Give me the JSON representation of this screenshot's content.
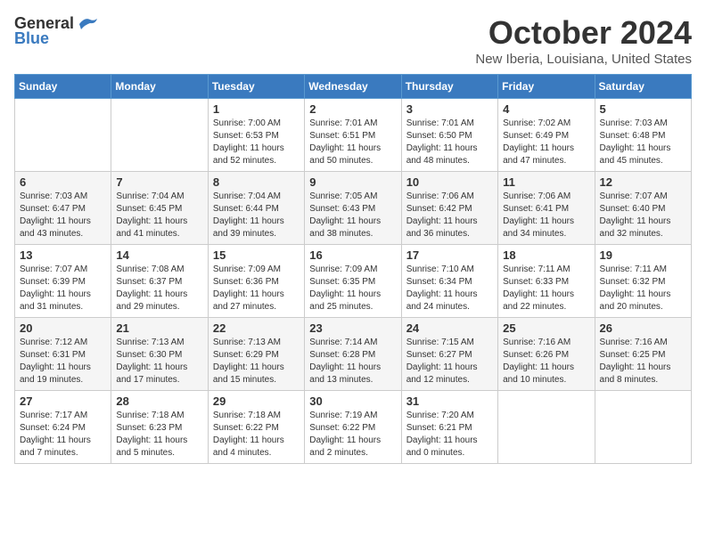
{
  "header": {
    "logo": {
      "general": "General",
      "blue": "Blue",
      "tagline": ""
    },
    "title": "October 2024",
    "location": "New Iberia, Louisiana, United States"
  },
  "weekdays": [
    "Sunday",
    "Monday",
    "Tuesday",
    "Wednesday",
    "Thursday",
    "Friday",
    "Saturday"
  ],
  "weeks": [
    [
      {
        "day": "",
        "sunrise": "",
        "sunset": "",
        "daylight": ""
      },
      {
        "day": "",
        "sunrise": "",
        "sunset": "",
        "daylight": ""
      },
      {
        "day": "1",
        "sunrise": "Sunrise: 7:00 AM",
        "sunset": "Sunset: 6:53 PM",
        "daylight": "Daylight: 11 hours and 52 minutes."
      },
      {
        "day": "2",
        "sunrise": "Sunrise: 7:01 AM",
        "sunset": "Sunset: 6:51 PM",
        "daylight": "Daylight: 11 hours and 50 minutes."
      },
      {
        "day": "3",
        "sunrise": "Sunrise: 7:01 AM",
        "sunset": "Sunset: 6:50 PM",
        "daylight": "Daylight: 11 hours and 48 minutes."
      },
      {
        "day": "4",
        "sunrise": "Sunrise: 7:02 AM",
        "sunset": "Sunset: 6:49 PM",
        "daylight": "Daylight: 11 hours and 47 minutes."
      },
      {
        "day": "5",
        "sunrise": "Sunrise: 7:03 AM",
        "sunset": "Sunset: 6:48 PM",
        "daylight": "Daylight: 11 hours and 45 minutes."
      }
    ],
    [
      {
        "day": "6",
        "sunrise": "Sunrise: 7:03 AM",
        "sunset": "Sunset: 6:47 PM",
        "daylight": "Daylight: 11 hours and 43 minutes."
      },
      {
        "day": "7",
        "sunrise": "Sunrise: 7:04 AM",
        "sunset": "Sunset: 6:45 PM",
        "daylight": "Daylight: 11 hours and 41 minutes."
      },
      {
        "day": "8",
        "sunrise": "Sunrise: 7:04 AM",
        "sunset": "Sunset: 6:44 PM",
        "daylight": "Daylight: 11 hours and 39 minutes."
      },
      {
        "day": "9",
        "sunrise": "Sunrise: 7:05 AM",
        "sunset": "Sunset: 6:43 PM",
        "daylight": "Daylight: 11 hours and 38 minutes."
      },
      {
        "day": "10",
        "sunrise": "Sunrise: 7:06 AM",
        "sunset": "Sunset: 6:42 PM",
        "daylight": "Daylight: 11 hours and 36 minutes."
      },
      {
        "day": "11",
        "sunrise": "Sunrise: 7:06 AM",
        "sunset": "Sunset: 6:41 PM",
        "daylight": "Daylight: 11 hours and 34 minutes."
      },
      {
        "day": "12",
        "sunrise": "Sunrise: 7:07 AM",
        "sunset": "Sunset: 6:40 PM",
        "daylight": "Daylight: 11 hours and 32 minutes."
      }
    ],
    [
      {
        "day": "13",
        "sunrise": "Sunrise: 7:07 AM",
        "sunset": "Sunset: 6:39 PM",
        "daylight": "Daylight: 11 hours and 31 minutes."
      },
      {
        "day": "14",
        "sunrise": "Sunrise: 7:08 AM",
        "sunset": "Sunset: 6:37 PM",
        "daylight": "Daylight: 11 hours and 29 minutes."
      },
      {
        "day": "15",
        "sunrise": "Sunrise: 7:09 AM",
        "sunset": "Sunset: 6:36 PM",
        "daylight": "Daylight: 11 hours and 27 minutes."
      },
      {
        "day": "16",
        "sunrise": "Sunrise: 7:09 AM",
        "sunset": "Sunset: 6:35 PM",
        "daylight": "Daylight: 11 hours and 25 minutes."
      },
      {
        "day": "17",
        "sunrise": "Sunrise: 7:10 AM",
        "sunset": "Sunset: 6:34 PM",
        "daylight": "Daylight: 11 hours and 24 minutes."
      },
      {
        "day": "18",
        "sunrise": "Sunrise: 7:11 AM",
        "sunset": "Sunset: 6:33 PM",
        "daylight": "Daylight: 11 hours and 22 minutes."
      },
      {
        "day": "19",
        "sunrise": "Sunrise: 7:11 AM",
        "sunset": "Sunset: 6:32 PM",
        "daylight": "Daylight: 11 hours and 20 minutes."
      }
    ],
    [
      {
        "day": "20",
        "sunrise": "Sunrise: 7:12 AM",
        "sunset": "Sunset: 6:31 PM",
        "daylight": "Daylight: 11 hours and 19 minutes."
      },
      {
        "day": "21",
        "sunrise": "Sunrise: 7:13 AM",
        "sunset": "Sunset: 6:30 PM",
        "daylight": "Daylight: 11 hours and 17 minutes."
      },
      {
        "day": "22",
        "sunrise": "Sunrise: 7:13 AM",
        "sunset": "Sunset: 6:29 PM",
        "daylight": "Daylight: 11 hours and 15 minutes."
      },
      {
        "day": "23",
        "sunrise": "Sunrise: 7:14 AM",
        "sunset": "Sunset: 6:28 PM",
        "daylight": "Daylight: 11 hours and 13 minutes."
      },
      {
        "day": "24",
        "sunrise": "Sunrise: 7:15 AM",
        "sunset": "Sunset: 6:27 PM",
        "daylight": "Daylight: 11 hours and 12 minutes."
      },
      {
        "day": "25",
        "sunrise": "Sunrise: 7:16 AM",
        "sunset": "Sunset: 6:26 PM",
        "daylight": "Daylight: 11 hours and 10 minutes."
      },
      {
        "day": "26",
        "sunrise": "Sunrise: 7:16 AM",
        "sunset": "Sunset: 6:25 PM",
        "daylight": "Daylight: 11 hours and 8 minutes."
      }
    ],
    [
      {
        "day": "27",
        "sunrise": "Sunrise: 7:17 AM",
        "sunset": "Sunset: 6:24 PM",
        "daylight": "Daylight: 11 hours and 7 minutes."
      },
      {
        "day": "28",
        "sunrise": "Sunrise: 7:18 AM",
        "sunset": "Sunset: 6:23 PM",
        "daylight": "Daylight: 11 hours and 5 minutes."
      },
      {
        "day": "29",
        "sunrise": "Sunrise: 7:18 AM",
        "sunset": "Sunset: 6:22 PM",
        "daylight": "Daylight: 11 hours and 4 minutes."
      },
      {
        "day": "30",
        "sunrise": "Sunrise: 7:19 AM",
        "sunset": "Sunset: 6:22 PM",
        "daylight": "Daylight: 11 hours and 2 minutes."
      },
      {
        "day": "31",
        "sunrise": "Sunrise: 7:20 AM",
        "sunset": "Sunset: 6:21 PM",
        "daylight": "Daylight: 11 hours and 0 minutes."
      },
      {
        "day": "",
        "sunrise": "",
        "sunset": "",
        "daylight": ""
      },
      {
        "day": "",
        "sunrise": "",
        "sunset": "",
        "daylight": ""
      }
    ]
  ]
}
